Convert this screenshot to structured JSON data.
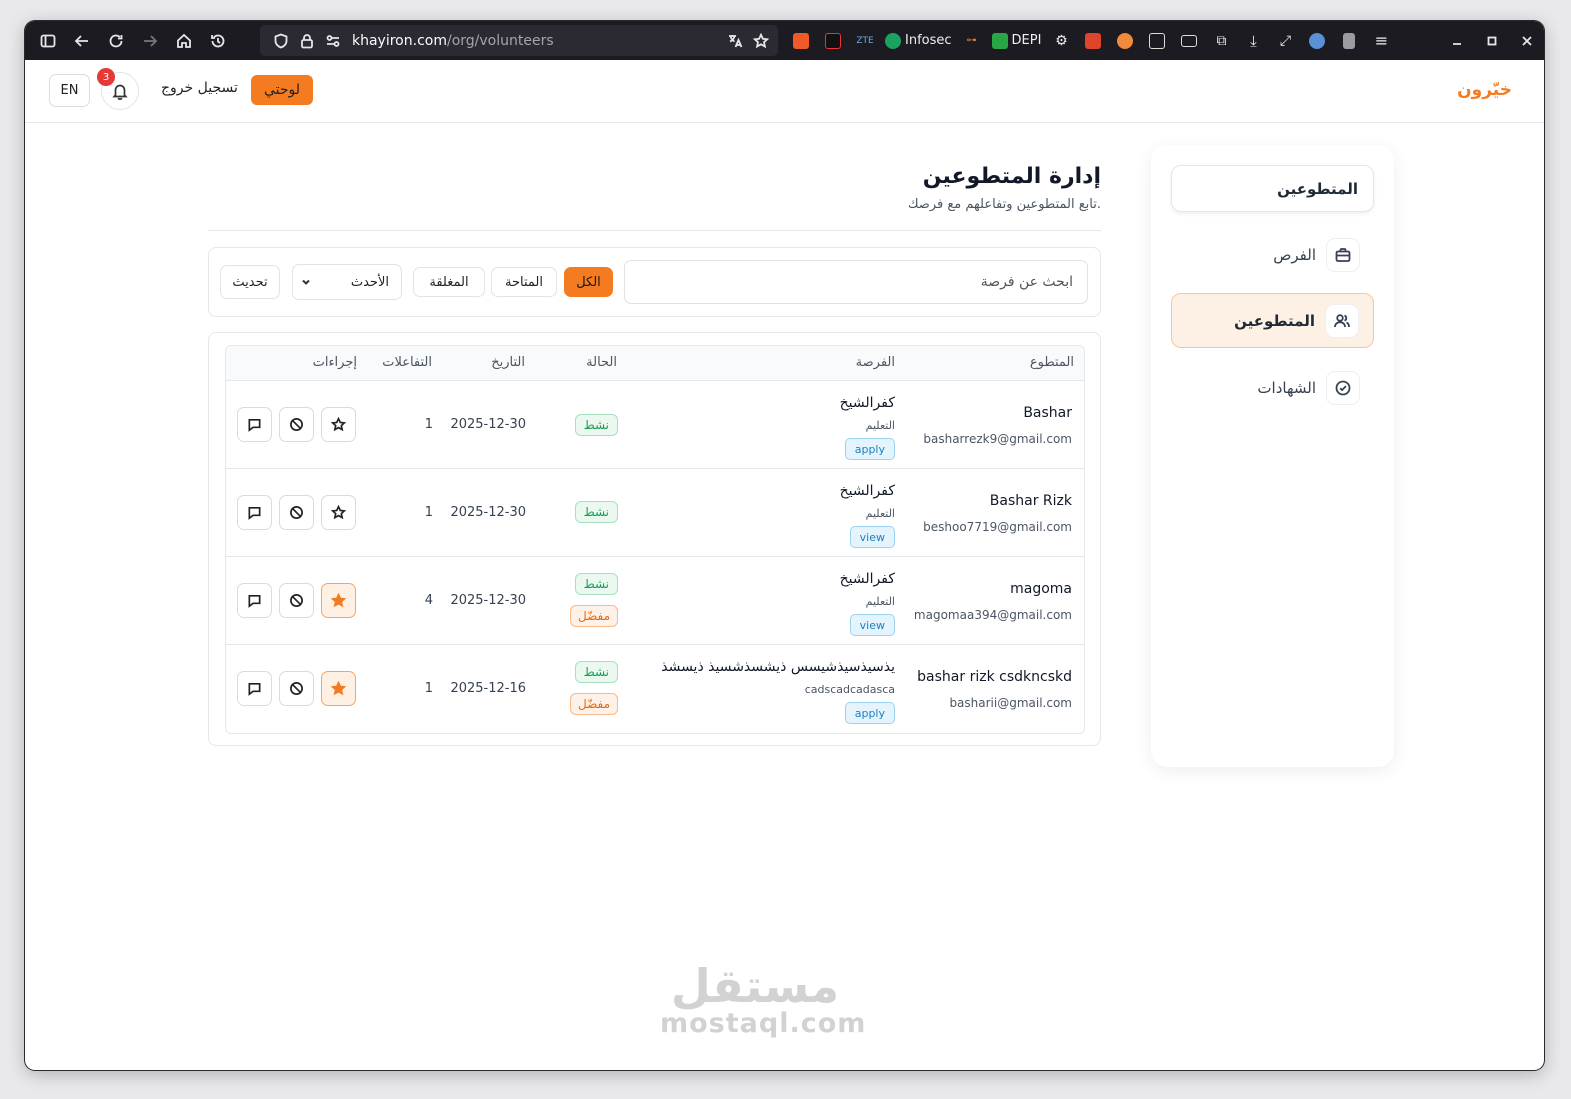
{
  "browser": {
    "url_host": "khayiron.com",
    "url_path": "/org/volunteers",
    "extensions": [
      "Infosec",
      "DEPI"
    ]
  },
  "header": {
    "brand": "خيّرون",
    "dashboard_label": "لوحتي",
    "logout_label": "تسجيل خروج",
    "notifications_count": "3",
    "lang_label": "EN"
  },
  "sidebar": {
    "title": "المتطوعين",
    "items": [
      {
        "label": "الفرص",
        "icon": "briefcase-icon"
      },
      {
        "label": "المتطوعين",
        "icon": "users-icon",
        "active": true
      },
      {
        "label": "الشهادات",
        "icon": "check-circle-icon"
      }
    ]
  },
  "main": {
    "title": "إدارة المتطوعين",
    "subtitle": "تابع المتطوعين وتفاعلهم مع فرصك.",
    "search_placeholder": "ابحث عن فرصة",
    "filters": {
      "all": "الكل",
      "available": "المتاحة",
      "closed": "المغلقة"
    },
    "sort_value": "الأحدث",
    "refresh_label": "تحديث"
  },
  "table": {
    "headers": {
      "volunteer": "المتطوع",
      "opportunity": "الفرصة",
      "status": "الحالة",
      "date": "التاريخ",
      "interactions": "التفاعلات",
      "actions": "إجراءات"
    },
    "rows": [
      {
        "name": "Bashar",
        "email": "basharrezk9@gmail.com",
        "opportunity": "كفرالشيخ",
        "category": "التعليم",
        "type": "apply",
        "status": "نشط",
        "favorite": false,
        "favorite_label": "",
        "date": "2025-12-30",
        "interactions": "1"
      },
      {
        "name": "Bashar Rizk",
        "email": "beshoo7719@gmail.com",
        "opportunity": "كفرالشيخ",
        "category": "التعليم",
        "type": "view",
        "status": "نشط",
        "favorite": false,
        "favorite_label": "",
        "date": "2025-12-30",
        "interactions": "1"
      },
      {
        "name": "magoma",
        "email": "magomaa394@gmail.com",
        "opportunity": "كفرالشيخ",
        "category": "التعليم",
        "type": "view",
        "status": "نشط",
        "favorite": true,
        "favorite_label": "مفضّل",
        "date": "2025-12-30",
        "interactions": "4"
      },
      {
        "name": "bashar rizk csdkncskd",
        "email": "basharii@gmail.com",
        "opportunity": "يذسيذسيذشيسس ذيشسذشسيذ ذيسشذ",
        "category": "cadscadcadasca",
        "type": "apply",
        "status": "نشط",
        "favorite": true,
        "favorite_label": "مفضّل",
        "date": "2025-12-16",
        "interactions": "1"
      }
    ]
  },
  "watermark": {
    "ar": "مستقل",
    "en": "mostaql.com"
  },
  "colors": {
    "accent": "#f47b20",
    "active_green": "#1f9a55",
    "link_blue": "#1d7fbf"
  }
}
